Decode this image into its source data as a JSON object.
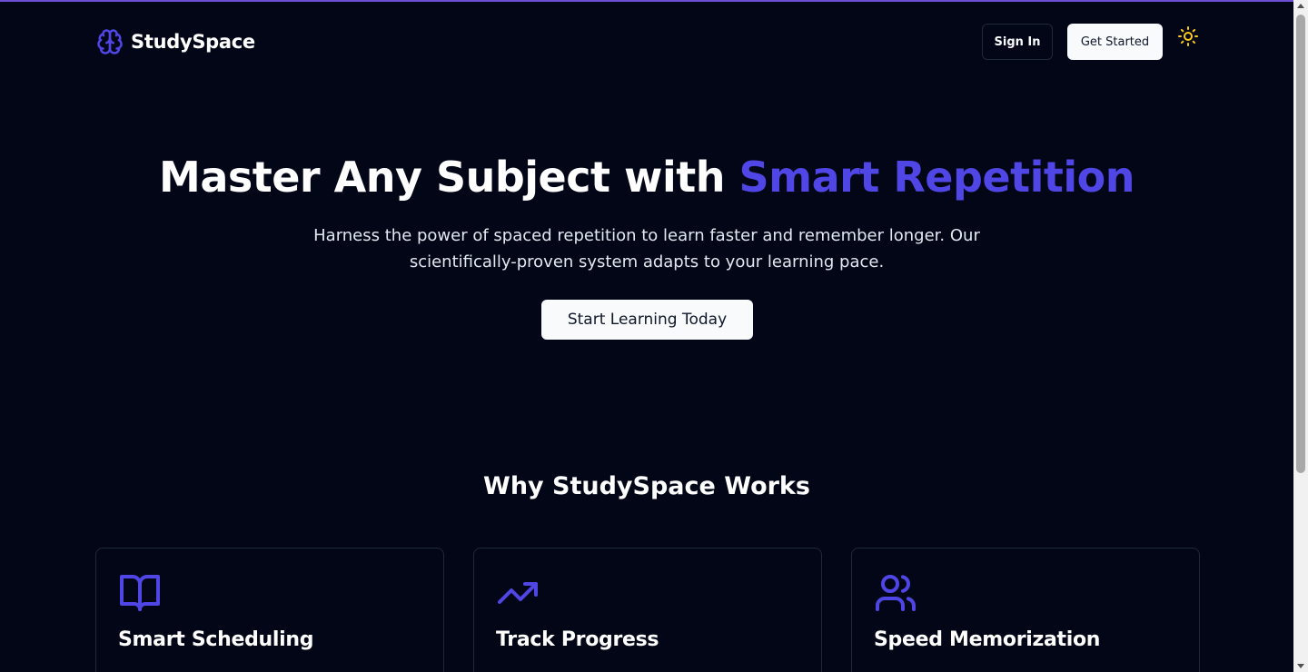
{
  "header": {
    "brand_name": "StudySpace",
    "brand_icon": "brain-icon",
    "sign_in_label": "Sign In",
    "get_started_label": "Get Started",
    "theme_toggle_icon": "sun-icon"
  },
  "hero": {
    "title_prefix": "Master Any Subject with ",
    "title_accent": "Smart Repetition",
    "subtitle": "Harness the power of spaced repetition to learn faster and remember longer. Our scientifically-proven system adapts to your learning pace.",
    "cta_label": "Start Learning Today"
  },
  "features": {
    "section_title": "Why StudySpace Works",
    "cards": [
      {
        "title": "Smart Scheduling",
        "icon": "book-open-icon"
      },
      {
        "title": "Track Progress",
        "icon": "trending-up-icon"
      },
      {
        "title": "Speed Memorization",
        "icon": "users-icon"
      }
    ]
  },
  "colors": {
    "background": "#020617",
    "accent": "#4f46e5",
    "text": "#ffffff",
    "button_light": "#f8fafc",
    "sun": "#facc15"
  }
}
